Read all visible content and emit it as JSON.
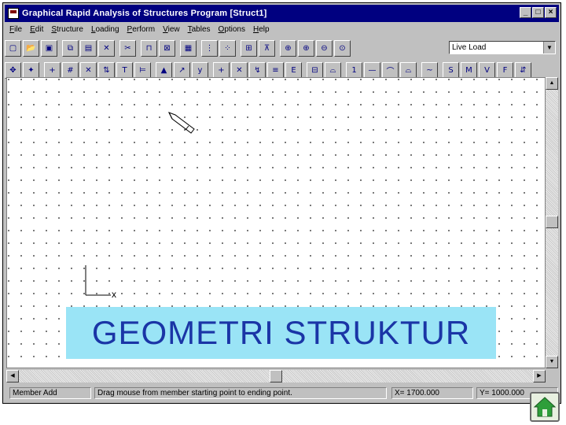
{
  "window": {
    "title": "Graphical Rapid Analysis of Structures Program [Struct1]",
    "buttons": [
      "_",
      "□",
      "×"
    ]
  },
  "menu": [
    "File",
    "Edit",
    "Structure",
    "Loading",
    "Perform",
    "View",
    "Tables",
    "Options",
    "Help"
  ],
  "toolbar1_icons": [
    "new-icon",
    "open-icon",
    "save-icon",
    "copy-icon",
    "paste-icon",
    "delete-icon",
    "cut-icon",
    "frame-icon",
    "zoom-window-icon",
    "snap-icon",
    "grid-points-icon",
    "dots-grid-icon",
    "frame-view-icon",
    "truss-icon",
    "zoom-all-icon",
    "zoom-in-icon",
    "zoom-out-icon",
    "zoom-restore-icon"
  ],
  "toolbar2_icons": [
    "select-node-icon",
    "select-member-icon",
    "add-node-icon",
    "number-nodes-icon",
    "delete-node-icon",
    "member-release-icon",
    "section-icon",
    "member-group-icon",
    "support-icon",
    "node-coordinate-icon",
    "xy-icon",
    "load-add-icon",
    "load-delete-icon",
    "node-load-icon",
    "member-load-icon",
    "distributed-load-icon",
    "moment-load-icon",
    "deflection-icon",
    "label-123-icon",
    "line-icon",
    "arc-icon",
    "moment-diagram-icon",
    "shear-diagram-icon",
    "force-s-icon",
    "force-m-icon",
    "force-v-icon",
    "force-f-icon",
    "reaction-icon"
  ],
  "load_case": "Live Load",
  "axis_label": "x",
  "banner": "GEOMETRI STRUKTUR",
  "status": {
    "mode": "Member Add",
    "hint": "Drag mouse from member starting point to ending point.",
    "x": "X= 1700.000",
    "y": "Y= 1000.000"
  },
  "colors": {
    "titlebar": "#000080",
    "banner_bg": "#9ae4f6",
    "banner_text": "#1a35a6"
  }
}
